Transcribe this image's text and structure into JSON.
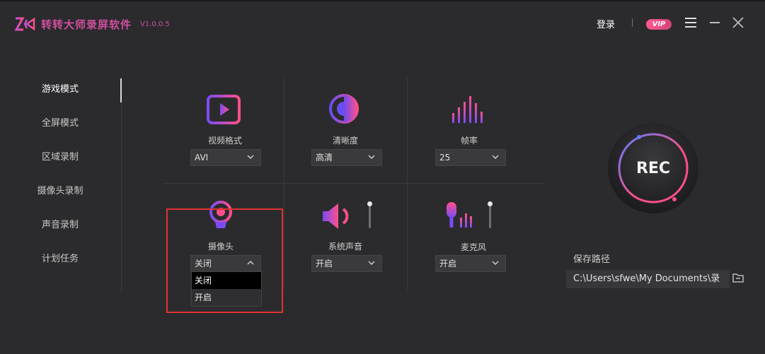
{
  "app": {
    "title": "转转大师录屏软件",
    "version": "V1.0.0.5"
  },
  "header": {
    "login_label": "登录",
    "vip_label": "VIP"
  },
  "sidebar": {
    "items": [
      {
        "label": "游戏模式",
        "active": true
      },
      {
        "label": "全屏模式"
      },
      {
        "label": "区域录制"
      },
      {
        "label": "摄像头录制"
      },
      {
        "label": "声音录制"
      },
      {
        "label": "计划任务"
      }
    ]
  },
  "settings": {
    "video_format": {
      "label": "视频格式",
      "value": "AVI"
    },
    "clarity": {
      "label": "清晰度",
      "value": "高清"
    },
    "frame_rate": {
      "label": "帧率",
      "value": "25"
    },
    "camera": {
      "label": "摄像头",
      "value": "关闭",
      "options": [
        "关闭",
        "开启"
      ]
    },
    "system_sound": {
      "label": "系统声音",
      "value": "开启"
    },
    "microphone": {
      "label": "麦克风",
      "value": "开启"
    }
  },
  "rec": {
    "label": "REC"
  },
  "save": {
    "label": "保存路径",
    "path": "C:\\Users\\sfwe\\My Documents\\录"
  },
  "colors": {
    "accent": "#d04ea0",
    "bg": "#2b2b2d",
    "highlight_box": "#e03131"
  },
  "icons": [
    "logo-icon",
    "video-play-icon",
    "clarity-icon",
    "frame-rate-icon",
    "camera-icon",
    "speaker-icon",
    "microphone-icon",
    "menu-icon",
    "minimize-icon",
    "close-icon",
    "folder-icon",
    "chevron-down-icon",
    "chevron-up-icon"
  ]
}
